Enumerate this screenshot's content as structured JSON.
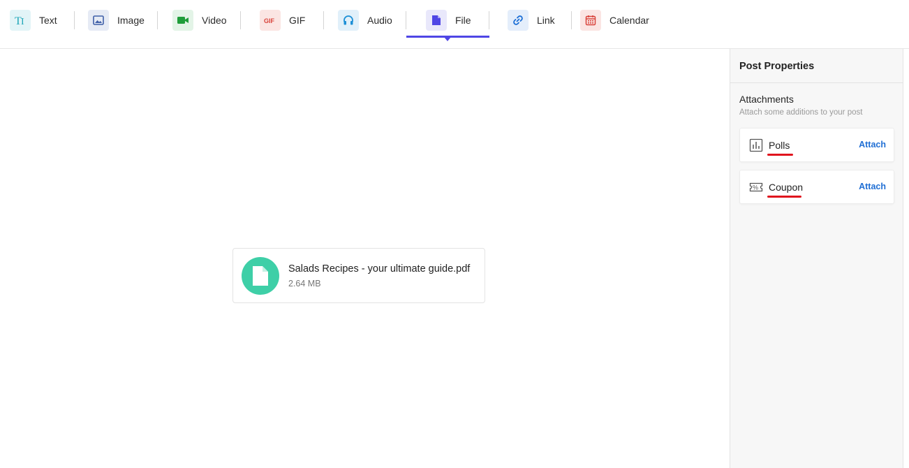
{
  "toolbar": {
    "tabs": [
      {
        "label": "Text",
        "icon": "text-type-icon",
        "color": "#1fa6b8",
        "bg": "#e2f4f7"
      },
      {
        "label": "Image",
        "icon": "image-icon",
        "color": "#3f5fa8",
        "bg": "#e6ebf5"
      },
      {
        "label": "Video",
        "icon": "video-camera-icon",
        "color": "#1f9d3a",
        "bg": "#e3f4e7"
      },
      {
        "label": "GIF",
        "icon": "gif-icon",
        "color": "#d9423a",
        "bg": "#fbe5e3"
      },
      {
        "label": "Audio",
        "icon": "headphones-icon",
        "color": "#1c8fd6",
        "bg": "#e1f0fa"
      },
      {
        "label": "File",
        "icon": "file-icon",
        "color": "#4f46e5",
        "bg": "#e9e8fb"
      },
      {
        "label": "Link",
        "icon": "link-icon",
        "color": "#1c6fd6",
        "bg": "#e4eefb"
      },
      {
        "label": "Calendar",
        "icon": "calendar-icon",
        "color": "#d9423a",
        "bg": "#fbe5e3"
      }
    ],
    "active_tab": "File",
    "accent_color": "#4f46e5"
  },
  "file": {
    "name": "Salads Recipes - your ultimate guide.pdf",
    "size": "2.64 MB",
    "icon": "file-icon",
    "color": "#3ecfa7"
  },
  "panel": {
    "title": "Post Properties",
    "attachments_title": "Attachments",
    "attachments_subtitle": "Attach some additions to your post",
    "items": [
      {
        "label": "Polls",
        "icon": "poll-chart-icon",
        "action": "Attach"
      },
      {
        "label": "Coupon",
        "icon": "coupon-icon",
        "action": "Attach"
      }
    ],
    "link_color": "#1f6ed4",
    "underline_color": "#e0141e"
  }
}
